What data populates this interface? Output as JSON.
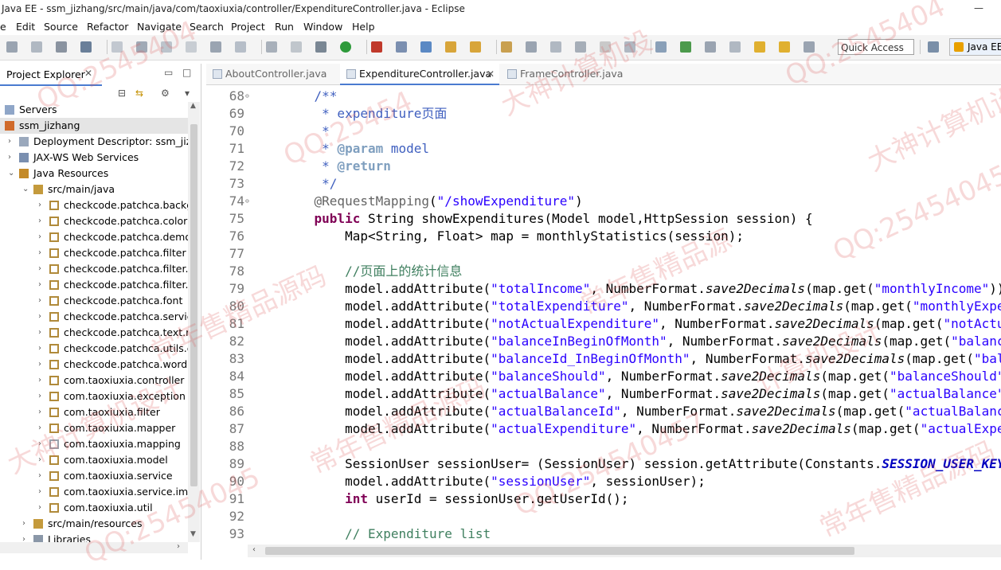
{
  "window": {
    "title": "Java EE - ssm_jizhang/src/main/java/com/taoxiuxia/controller/ExpenditureController.java - Eclipse",
    "minimize_glyph": "—"
  },
  "menu": [
    "e",
    "Edit",
    "Source",
    "Refactor",
    "Navigate",
    "Search",
    "Project",
    "Run",
    "Window",
    "Help"
  ],
  "toolbar": {
    "quick_access_placeholder": "Quick Access",
    "perspective_label": "Java EE"
  },
  "explorer": {
    "tab_label": "Project Explorer",
    "close_glyph": "✕",
    "tree": [
      {
        "label": "Servers",
        "indent": 0,
        "arrow": "",
        "icon": "folder"
      },
      {
        "label": "ssm_jizhang",
        "indent": 0,
        "arrow": "",
        "icon": "project",
        "selected": true
      },
      {
        "label": "Deployment Descriptor: ssm_jizh",
        "indent": 1,
        "arrow": "›",
        "icon": "dd"
      },
      {
        "label": "JAX-WS Web Services",
        "indent": 1,
        "arrow": "›",
        "icon": "ws"
      },
      {
        "label": "Java Resources",
        "indent": 1,
        "arrow": "⌄",
        "icon": "jr"
      },
      {
        "label": "src/main/java",
        "indent": 2,
        "arrow": "⌄",
        "icon": "src"
      },
      {
        "label": "checkcode.patchca.backg",
        "indent": 3,
        "arrow": "›",
        "icon": "pkg"
      },
      {
        "label": "checkcode.patchca.color",
        "indent": 3,
        "arrow": "›",
        "icon": "pkg"
      },
      {
        "label": "checkcode.patchca.demo",
        "indent": 3,
        "arrow": "›",
        "icon": "pkg"
      },
      {
        "label": "checkcode.patchca.filter",
        "indent": 3,
        "arrow": "›",
        "icon": "pkg"
      },
      {
        "label": "checkcode.patchca.filter.lil",
        "indent": 3,
        "arrow": "›",
        "icon": "pkg"
      },
      {
        "label": "checkcode.patchca.filter.p",
        "indent": 3,
        "arrow": "›",
        "icon": "pkg"
      },
      {
        "label": "checkcode.patchca.font",
        "indent": 3,
        "arrow": "›",
        "icon": "pkg"
      },
      {
        "label": "checkcode.patchca.service",
        "indent": 3,
        "arrow": "›",
        "icon": "pkg"
      },
      {
        "label": "checkcode.patchca.text.re",
        "indent": 3,
        "arrow": "›",
        "icon": "pkg"
      },
      {
        "label": "checkcode.patchca.utils.er",
        "indent": 3,
        "arrow": "›",
        "icon": "pkg"
      },
      {
        "label": "checkcode.patchca.word",
        "indent": 3,
        "arrow": "›",
        "icon": "pkg"
      },
      {
        "label": "com.taoxiuxia.controller",
        "indent": 3,
        "arrow": "›",
        "icon": "pkg"
      },
      {
        "label": "com.taoxiuxia.exception",
        "indent": 3,
        "arrow": "›",
        "icon": "pkg"
      },
      {
        "label": "com.taoxiuxia.filter",
        "indent": 3,
        "arrow": "›",
        "icon": "pkg"
      },
      {
        "label": "com.taoxiuxia.mapper",
        "indent": 3,
        "arrow": "›",
        "icon": "pkg"
      },
      {
        "label": "com.taoxiuxia.mapping",
        "indent": 3,
        "arrow": "›",
        "icon": "pkge"
      },
      {
        "label": "com.taoxiuxia.model",
        "indent": 3,
        "arrow": "›",
        "icon": "pkg"
      },
      {
        "label": "com.taoxiuxia.service",
        "indent": 3,
        "arrow": "›",
        "icon": "pkg"
      },
      {
        "label": "com.taoxiuxia.service.impl",
        "indent": 3,
        "arrow": "›",
        "icon": "pkg"
      },
      {
        "label": "com.taoxiuxia.util",
        "indent": 3,
        "arrow": "›",
        "icon": "pkg"
      },
      {
        "label": "src/main/resources",
        "indent": 2,
        "arrow": "›",
        "icon": "src"
      },
      {
        "label": "Libraries",
        "indent": 2,
        "arrow": "›",
        "icon": "lib"
      }
    ]
  },
  "editor": {
    "tabs": [
      {
        "label": "AboutController.java",
        "active": false
      },
      {
        "label": "ExpenditureController.java",
        "active": true
      },
      {
        "label": "FrameController.java",
        "active": false
      }
    ],
    "lines": [
      {
        "n": "68",
        "fold": true,
        "html": "    <span class='jd'>/**</span>"
      },
      {
        "n": "69",
        "html": "<span class='jd'>     * expenditure页面</span>"
      },
      {
        "n": "70",
        "html": "<span class='jd'>     *</span>"
      },
      {
        "n": "71",
        "html": "<span class='jd'>     * </span><span class='jt'>@param</span><span class='jd'> model</span>"
      },
      {
        "n": "72",
        "html": "<span class='jd'>     * </span><span class='jt'>@return</span>"
      },
      {
        "n": "73",
        "html": "<span class='jd'>     */</span>"
      },
      {
        "n": "74",
        "fold": true,
        "html": "    <span class='an'>@RequestMapping</span>(<span class='s'>\"/showExpenditure\"</span>)"
      },
      {
        "n": "75",
        "html": "    <span class='k'>public</span> String showExpenditures(Model model,HttpSession session) {"
      },
      {
        "n": "76",
        "html": "        Map&lt;String, Float&gt; map = monthlyStatistics(session);"
      },
      {
        "n": "77",
        "html": ""
      },
      {
        "n": "78",
        "html": "        <span class='c'>//页面上的统计信息</span>"
      },
      {
        "n": "79",
        "html": "        model.addAttribute(<span class='s'>\"totalIncome\"</span>, NumberFormat.<span class='it'>save2Decimals</span>(map.get(<span class='s'>\"monthlyIncome\"</span>)));"
      },
      {
        "n": "80",
        "html": "        model.addAttribute(<span class='s'>\"totalExpenditure\"</span>, NumberFormat.<span class='it'>save2Decimals</span>(map.get(<span class='s'>\"monthlyExpenditure\"</span>)));"
      },
      {
        "n": "81",
        "html": "        model.addAttribute(<span class='s'>\"notActualExpenditure\"</span>, NumberFormat.<span class='it'>save2Decimals</span>(map.get(<span class='s'>\"notActualExpenditure\"</span>)));"
      },
      {
        "n": "82",
        "html": "        model.addAttribute(<span class='s'>\"balanceInBeginOfMonth\"</span>, NumberFormat.<span class='it'>save2Decimals</span>(map.get(<span class='s'>\"balanceInBeginOfMonth\"</span>)));"
      },
      {
        "n": "83",
        "html": "        model.addAttribute(<span class='s'>\"balanceId_InBeginOfMonth\"</span>, NumberFormat.<span class='it'>save2Decimals</span>(map.get(<span class='s'>\"balanceId_InBeginOfMonth\"</span>)));"
      },
      {
        "n": "84",
        "html": "        model.addAttribute(<span class='s'>\"balanceShould\"</span>, NumberFormat.<span class='it'>save2Decimals</span>(map.get(<span class='s'>\"balanceShould\"</span>)));"
      },
      {
        "n": "85",
        "html": "        model.addAttribute(<span class='s'>\"actualBalance\"</span>, NumberFormat.<span class='it'>save2Decimals</span>(map.get(<span class='s'>\"actualBalance\"</span>)));"
      },
      {
        "n": "86",
        "html": "        model.addAttribute(<span class='s'>\"actualBalanceId\"</span>, NumberFormat.<span class='it'>save2Decimals</span>(map.get(<span class='s'>\"actualBalanceId\"</span>)));"
      },
      {
        "n": "87",
        "html": "        model.addAttribute(<span class='s'>\"actualExpenditure\"</span>, NumberFormat.<span class='it'>save2Decimals</span>(map.get(<span class='s'>\"actualExpenditure\"</span>)));"
      },
      {
        "n": "88",
        "html": ""
      },
      {
        "n": "89",
        "html": "        SessionUser sessionUser= (SessionUser) session.getAttribute(Constants.<span class='st'>SESSION_USER_KEY</span>);"
      },
      {
        "n": "90",
        "html": "        model.addAttribute(<span class='s'>\"sessionUser\"</span>, sessionUser);"
      },
      {
        "n": "91",
        "html": "        <span class='k'>int</span> userId = sessionUser.getUserId();"
      },
      {
        "n": "92",
        "html": ""
      },
      {
        "n": "93",
        "html": "        <span class='c'>// Expenditure list</span>"
      }
    ]
  },
  "watermarks": [
    "QQ:25454",
    "大神计算机设",
    "常年售精品源码",
    "QQ:2545404",
    "常年售精品源",
    "大神计算机设计",
    "QQ:254540457",
    "QQ:25454045",
    "常年售精品源码",
    "计算机设计",
    "QQ:2545404",
    "常年售精品源码",
    "大神计算机设计",
    "QQ:254540457"
  ]
}
